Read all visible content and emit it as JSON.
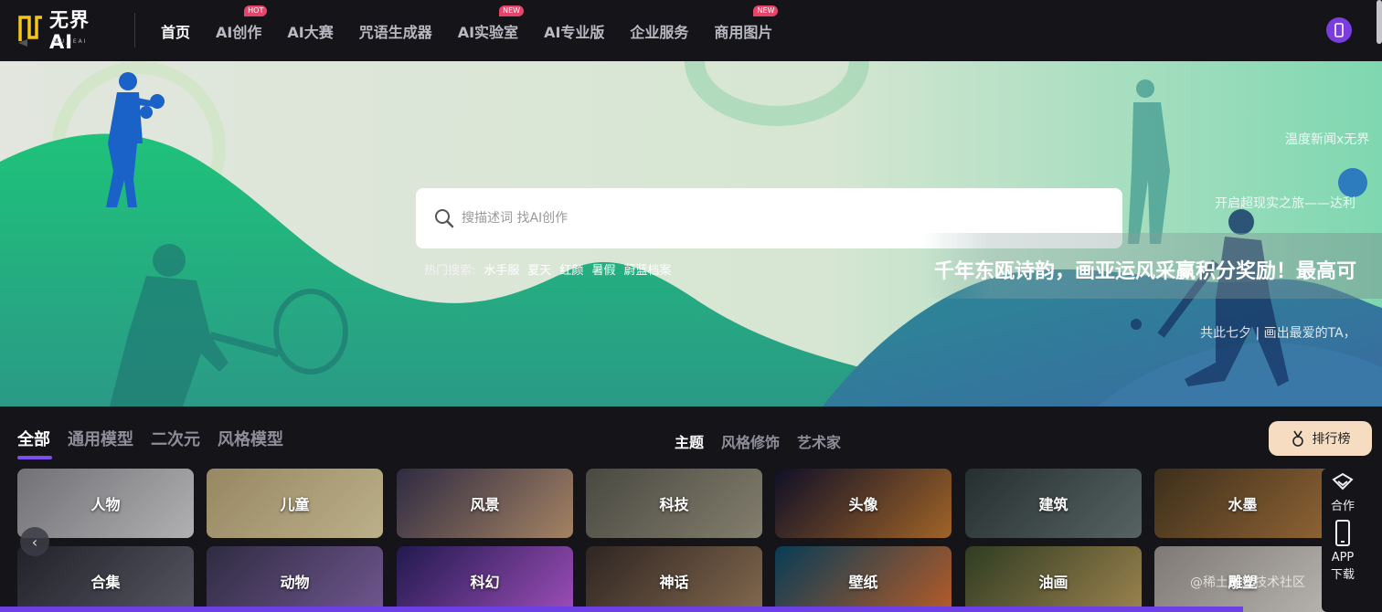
{
  "header": {
    "logo_text": "无界AI",
    "logo_sub": "WUJIEAI",
    "nav": [
      {
        "label": "首页",
        "badge": ""
      },
      {
        "label": "AI创作",
        "badge": "HOT"
      },
      {
        "label": "AI大赛",
        "badge": ""
      },
      {
        "label": "咒语生成器",
        "badge": ""
      },
      {
        "label": "AI实验室",
        "badge": "NEW"
      },
      {
        "label": "AI专业版",
        "badge": ""
      },
      {
        "label": "企业服务",
        "badge": ""
      },
      {
        "label": "商用图片",
        "badge": "NEW"
      }
    ]
  },
  "banner": {
    "search_placeholder": "搜描述词 找AI创作",
    "hot_label": "热门搜索:",
    "hot_tags": [
      "水手服",
      "夏天",
      "红颜",
      "暑假",
      "蔚蓝档案"
    ],
    "tickers": [
      "温度新闻x无界",
      "开启超现实之旅——达利",
      "千年东瓯诗韵，画亚运风采赢积分奖励！最高可",
      "共此七夕 | 画出最爱的TA，"
    ]
  },
  "categories": {
    "main_tabs": [
      "全部",
      "通用模型",
      "二次元",
      "风格模型"
    ],
    "sub_tabs": [
      "主题",
      "风格修饰",
      "艺术家"
    ],
    "rank_label": "排行榜"
  },
  "cards": [
    {
      "label": "人物",
      "colors": [
        "#8a8a90",
        "#d8d8da"
      ]
    },
    {
      "label": "儿童",
      "colors": [
        "#b9a67a",
        "#e4d7a8"
      ]
    },
    {
      "label": "风景",
      "colors": [
        "#3a3550",
        "#c8a07a"
      ]
    },
    {
      "label": "科技",
      "colors": [
        "#5a5a50",
        "#a09a86"
      ]
    },
    {
      "label": "头像",
      "colors": [
        "#141430",
        "#c47a30"
      ]
    },
    {
      "label": "建筑",
      "colors": [
        "#2e3a3a",
        "#6a7a78"
      ]
    },
    {
      "label": "水墨",
      "colors": [
        "#4a3a22",
        "#b07a40"
      ]
    },
    {
      "label": "合集",
      "colors": [
        "#2a2a35",
        "#6a6a78"
      ]
    },
    {
      "label": "动物",
      "colors": [
        "#3a3650",
        "#8a6ab0"
      ]
    },
    {
      "label": "科幻",
      "colors": [
        "#2a2060",
        "#c060e0"
      ]
    },
    {
      "label": "神话",
      "colors": [
        "#3a2e2a",
        "#a08060"
      ]
    },
    {
      "label": "壁纸",
      "colors": [
        "#0a4a6a",
        "#e07030"
      ]
    },
    {
      "label": "油画",
      "colors": [
        "#3a4a2a",
        "#c0a060"
      ]
    },
    {
      "label": "雕塑",
      "colors": [
        "#9a9490",
        "#e0dcd6"
      ]
    }
  ],
  "side_panel": {
    "cooperate": "合作",
    "app": "APP",
    "download": "下载"
  },
  "watermark": "@稀土掘金技术社区"
}
